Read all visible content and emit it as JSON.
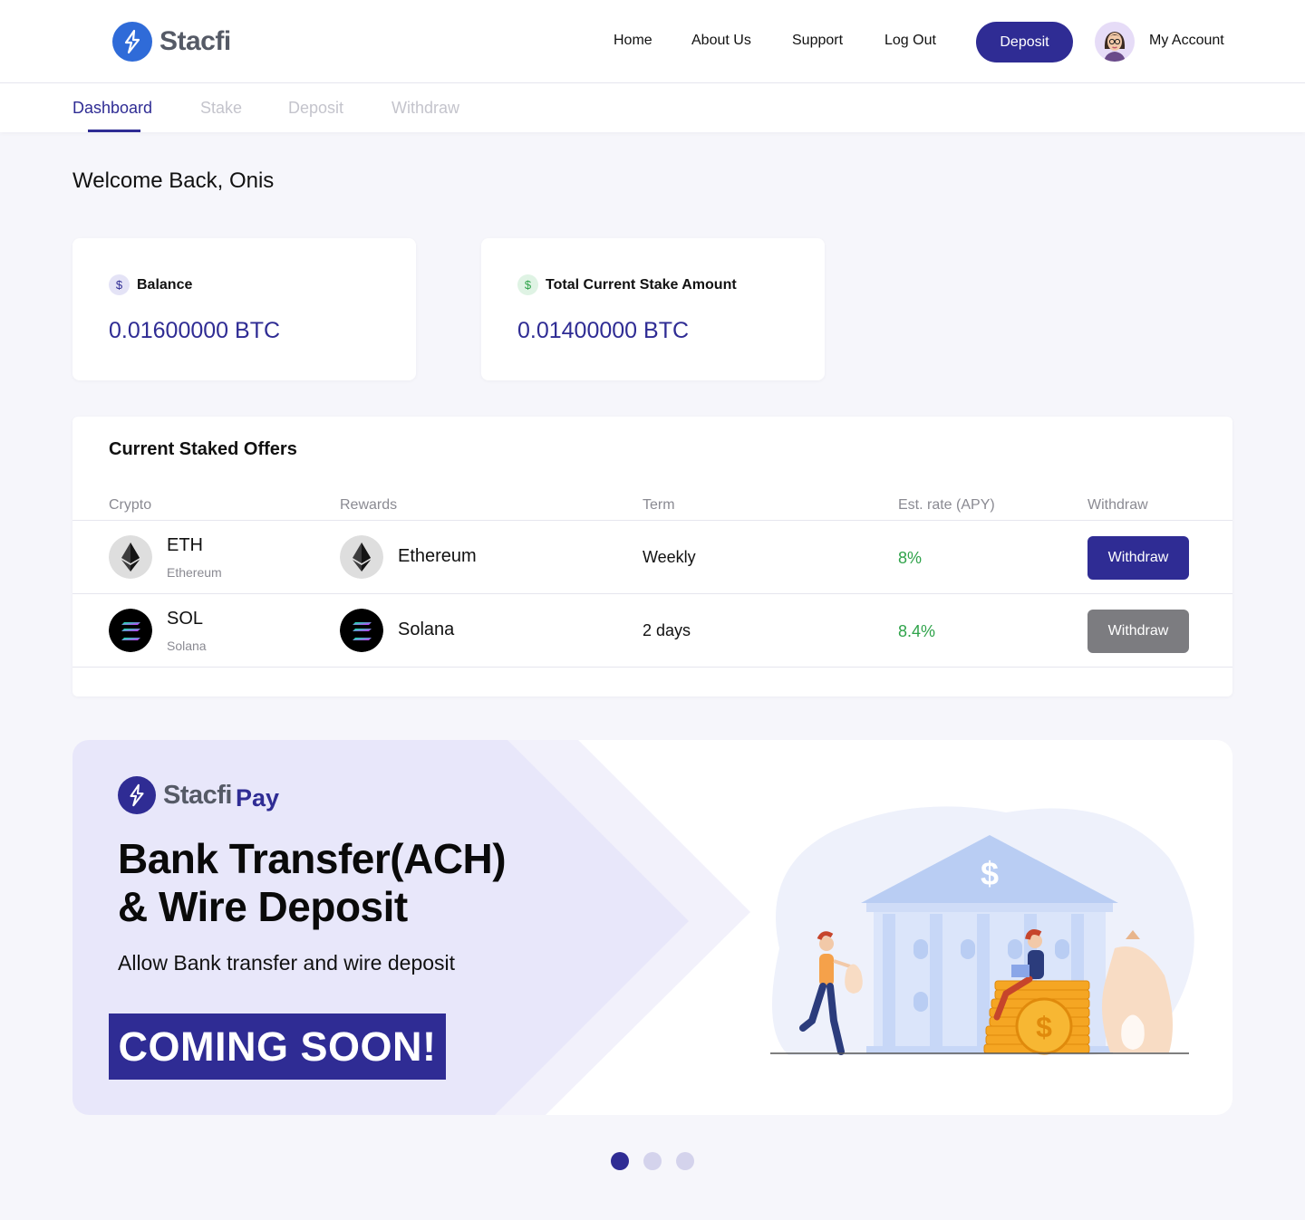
{
  "brand": {
    "name": "Stacfi",
    "pay_suffix": "Pay",
    "primary_color": "#2f2c94",
    "logo_color": "#2f6bd8"
  },
  "header": {
    "nav": [
      "Home",
      "About Us",
      "Support",
      "Log Out"
    ],
    "deposit_label": "Deposit",
    "account_label": "My Account"
  },
  "tabs": [
    "Dashboard",
    "Stake",
    "Deposit",
    "Withdraw"
  ],
  "active_tab": "Dashboard",
  "welcome": "Welcome Back, Onis",
  "cards": [
    {
      "label": "Balance",
      "value": "0.01600000 BTC",
      "icon": "$",
      "icon_color": "#2f2c94"
    },
    {
      "label": "Total Current Stake Amount",
      "value": "0.01400000 BTC",
      "icon": "$",
      "icon_color": "#2fa34a"
    }
  ],
  "offers": {
    "title": "Current Staked Offers",
    "columns": [
      "Crypto",
      "Rewards",
      "Term",
      "Est. rate (APY)",
      "Withdraw"
    ],
    "rows": [
      {
        "symbol": "ETH",
        "name": "Ethereum",
        "reward": "Ethereum",
        "term": "Weekly",
        "rate": "8%",
        "action": "Withdraw",
        "action_enabled": true,
        "icon": "ethereum-icon"
      },
      {
        "symbol": "SOL",
        "name": "Solana",
        "reward": "Solana",
        "term": "2 days",
        "rate": "8.4%",
        "action": "Withdraw",
        "action_enabled": false,
        "icon": "solana-icon"
      }
    ]
  },
  "banner": {
    "headline_line1": "Bank Transfer(ACH)",
    "headline_line2": "& Wire Deposit",
    "tagline": "Allow Bank transfer and wire deposit",
    "cta": "COMING SOON!"
  },
  "carousel": {
    "count": 3,
    "active": 0
  }
}
